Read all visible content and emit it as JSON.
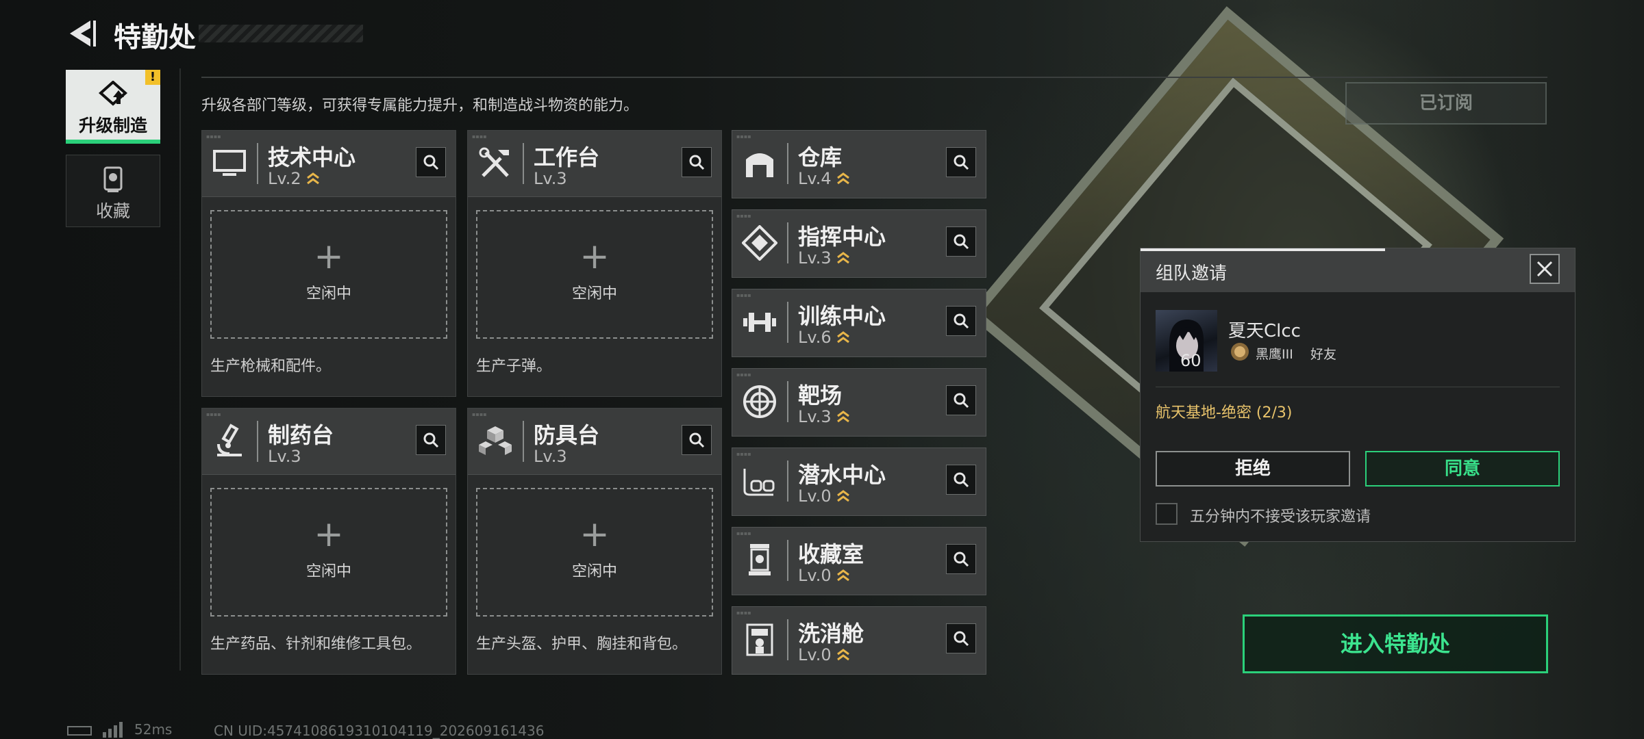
{
  "header": {
    "title": "特勤处",
    "back_icon": "back-arrow-icon"
  },
  "nav": {
    "items": [
      {
        "label": "升级制造",
        "icon": "upgrade-icon",
        "badge": "!",
        "active": true
      },
      {
        "label": "收藏",
        "icon": "collection-icon",
        "active": false
      }
    ]
  },
  "description": "升级各部门等级，可获得专属能力提升，和制造战斗物资的能力。",
  "subscribed_label": "已订阅",
  "workstations": [
    {
      "name": "技术中心",
      "level": "Lv.2",
      "upgradable": true,
      "icon": "monitor-icon",
      "slot_label": "空闲中",
      "desc": "生产枪械和配件。"
    },
    {
      "name": "工作台",
      "level": "Lv.3",
      "upgradable": false,
      "icon": "tools-icon",
      "slot_label": "空闲中",
      "desc": "生产子弹。"
    },
    {
      "name": "制药台",
      "level": "Lv.3",
      "upgradable": false,
      "icon": "microscope-icon",
      "slot_label": "空闲中",
      "desc": "生产药品、针剂和维修工具包。"
    },
    {
      "name": "防具台",
      "level": "Lv.3",
      "upgradable": false,
      "icon": "armor-blocks-icon",
      "slot_label": "空闲中",
      "desc": "生产头盔、护甲、胸挂和背包。"
    }
  ],
  "departments": [
    {
      "name": "仓库",
      "level": "Lv.4",
      "upgradable": true,
      "icon": "warehouse-icon"
    },
    {
      "name": "指挥中心",
      "level": "Lv.3",
      "upgradable": true,
      "icon": "command-icon"
    },
    {
      "name": "训练中心",
      "level": "Lv.6",
      "upgradable": true,
      "icon": "dumbbell-icon"
    },
    {
      "name": "靶场",
      "level": "Lv.3",
      "upgradable": true,
      "icon": "target-icon"
    },
    {
      "name": "潜水中心",
      "level": "Lv.0",
      "upgradable": true,
      "icon": "diving-mask-icon"
    },
    {
      "name": "收藏室",
      "level": "Lv.0",
      "upgradable": true,
      "icon": "display-case-icon"
    },
    {
      "name": "洗消舱",
      "level": "Lv.0",
      "upgradable": true,
      "icon": "decon-icon"
    }
  ],
  "invite": {
    "title": "组队邀请",
    "player_name": "夏天Clcc",
    "player_level": "60",
    "rank": "黑鹰III",
    "relation": "好友",
    "map": "航天基地-绝密 (2/3)",
    "refuse": "拒绝",
    "agree": "同意",
    "mute_option": "五分钟内不接受该玩家邀请"
  },
  "enter_button": "进入特勤处",
  "status_bar": {
    "ping": "52ms",
    "uid": "CN UID:4574108619310104119_202609161436"
  },
  "colors": {
    "accent_green": "#2bd07a",
    "upgrade_arrow": "#e8b64a",
    "map_text": "#e8c36b"
  }
}
